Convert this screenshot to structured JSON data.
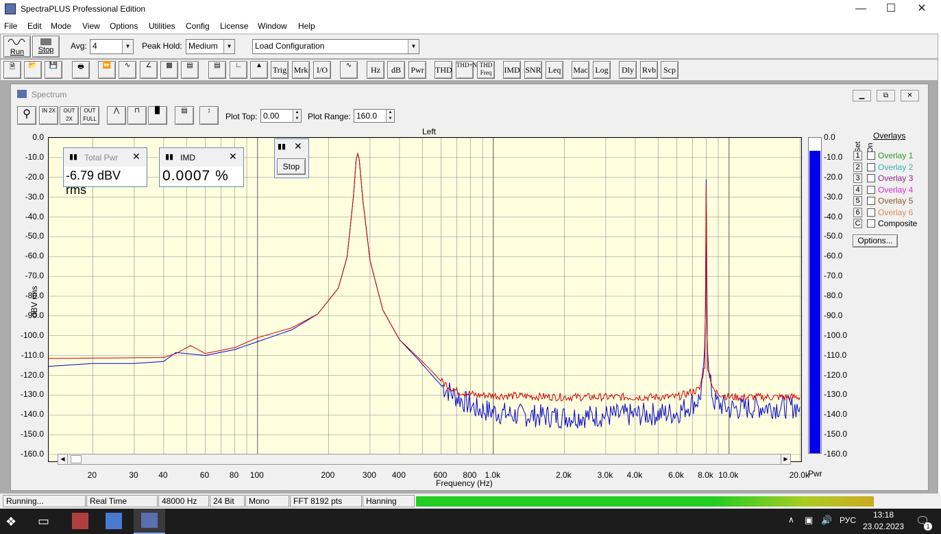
{
  "titlebar": {
    "title": "SpectraPLUS Professional Edition"
  },
  "menu": [
    "File",
    "Edit",
    "Mode",
    "View",
    "Options",
    "Utilities",
    "Config",
    "License",
    "Window",
    "Help"
  ],
  "toolbar1": {
    "run_label": "Run",
    "stop_label": "Stop",
    "avg_label": "Avg:",
    "avg_value": "4",
    "peak_hold_label": "Peak Hold:",
    "peak_hold_value": "Medium",
    "config_value": "Load Configuration"
  },
  "toolbar2": {
    "text_buttons": [
      "Trig",
      "Mrk",
      "I/O",
      "Hz",
      "dB",
      "Pwr",
      "THD",
      "THD+N",
      "THD Freq",
      "IMD",
      "SNR",
      "Leq",
      "Mac",
      "Log",
      "Dly",
      "Rvb",
      "Scp"
    ]
  },
  "spectrum": {
    "title": "Spectrum",
    "zoom_buttons": [
      "IN 2X",
      "OUT 2X",
      "OUT FULL"
    ],
    "plot_top_label": "Plot Top:",
    "plot_top_value": "0.00",
    "plot_range_label": "Plot Range:",
    "plot_range_value": "160.0",
    "channel": "Left",
    "overlays": {
      "title": "Overlays",
      "set_label": "Set",
      "on_label": "On",
      "items": [
        {
          "num": "1",
          "name": "Overlay 1",
          "color": "#2a9a2a"
        },
        {
          "num": "2",
          "name": "Overlay 2",
          "color": "#3aaeb8"
        },
        {
          "num": "3",
          "name": "Overlay 3",
          "color": "#8a2a8a"
        },
        {
          "num": "4",
          "name": "Overlay 4",
          "color": "#d030d0"
        },
        {
          "num": "5",
          "name": "Overlay 5",
          "color": "#8a5a2a"
        },
        {
          "num": "6",
          "name": "Overlay 6",
          "color": "#e08a5a"
        },
        {
          "num": "C",
          "name": "Composite",
          "color": "#000000"
        }
      ],
      "options_label": "Options..."
    },
    "total_pwr": {
      "title": "Total Pwr",
      "value": "-6.79 dBV rms"
    },
    "imd": {
      "title": "IMD",
      "value": "0.0007 %"
    },
    "mini_stop_label": "Stop",
    "pwr_level_db": -6.79
  },
  "chart_data": {
    "type": "line",
    "xlabel": "Frequency (Hz)",
    "ylabel": "dBV rms",
    "xscale": "log",
    "xlim": [
      13,
      20500
    ],
    "ylim": [
      -160,
      0
    ],
    "x_ticks": [
      "20",
      "30",
      "40",
      "60",
      "80",
      "100",
      "200",
      "300",
      "400",
      "600",
      "800",
      "1.0k",
      "2.0k",
      "3.0k",
      "4.0k",
      "6.0k",
      "8.0k",
      "10.0k",
      "20.0k"
    ],
    "x_tick_values": [
      20,
      30,
      40,
      60,
      80,
      100,
      200,
      300,
      400,
      600,
      800,
      1000,
      2000,
      3000,
      4000,
      6000,
      8000,
      10000,
      20000
    ],
    "y_ticks": [
      "0.0",
      "-10.0",
      "-20.0",
      "-30.0",
      "-40.0",
      "-50.0",
      "-60.0",
      "-70.0",
      "-80.0",
      "-90.0",
      "-100.0",
      "-110.0",
      "-120.0",
      "-130.0",
      "-140.0",
      "-150.0",
      "-160.0"
    ],
    "right_label": "Pwr",
    "grid": true,
    "series": [
      {
        "color": "#0000cc",
        "points": [
          [
            13,
            -115.5
          ],
          [
            20,
            -114
          ],
          [
            30,
            -114
          ],
          [
            40,
            -113
          ],
          [
            45,
            -108.5
          ],
          [
            50,
            -109
          ],
          [
            60,
            -110
          ],
          [
            80,
            -107
          ],
          [
            100,
            -103
          ],
          [
            140,
            -97
          ],
          [
            180,
            -89
          ],
          [
            220,
            -76
          ],
          [
            240,
            -60
          ],
          [
            255,
            -30
          ],
          [
            262,
            -11
          ],
          [
            266,
            -8
          ],
          [
            270,
            -11
          ],
          [
            280,
            -32
          ],
          [
            300,
            -62
          ],
          [
            340,
            -87
          ],
          [
            400,
            -102
          ],
          [
            480,
            -112
          ],
          [
            550,
            -120
          ],
          [
            600,
            -125
          ],
          [
            700,
            -131
          ],
          [
            850,
            -137
          ],
          [
            1200,
            -140
          ],
          [
            2000,
            -141
          ],
          [
            4000,
            -140
          ],
          [
            6000,
            -139
          ],
          [
            7500,
            -132
          ],
          [
            7800,
            -120
          ],
          [
            7950,
            -90
          ],
          [
            8000,
            -20
          ],
          [
            8050,
            -90
          ],
          [
            8200,
            -120
          ],
          [
            8600,
            -133
          ],
          [
            10000,
            -137
          ],
          [
            14000,
            -136
          ],
          [
            20000,
            -136
          ]
        ]
      },
      {
        "color": "#cc0000",
        "points": [
          [
            13,
            -111.5
          ],
          [
            40,
            -111
          ],
          [
            45,
            -109
          ],
          [
            52,
            -105
          ],
          [
            60,
            -109
          ],
          [
            80,
            -106
          ],
          [
            100,
            -101
          ],
          [
            140,
            -96
          ],
          [
            180,
            -89
          ],
          [
            220,
            -76
          ],
          [
            240,
            -60
          ],
          [
            255,
            -30
          ],
          [
            262,
            -11
          ],
          [
            266,
            -8
          ],
          [
            270,
            -11
          ],
          [
            280,
            -32
          ],
          [
            300,
            -62
          ],
          [
            340,
            -87
          ],
          [
            400,
            -102
          ],
          [
            480,
            -111
          ],
          [
            550,
            -118
          ],
          [
            600,
            -123
          ],
          [
            700,
            -128
          ],
          [
            850,
            -130
          ],
          [
            2000,
            -131
          ],
          [
            6000,
            -131
          ],
          [
            7500,
            -127
          ],
          [
            7900,
            -115
          ],
          [
            8000,
            -25
          ],
          [
            8100,
            -115
          ],
          [
            8600,
            -128
          ],
          [
            10000,
            -131
          ],
          [
            14000,
            -131
          ],
          [
            20000,
            -131
          ]
        ]
      }
    ]
  },
  "statusbar": {
    "state": "Running...",
    "mode": "Real Time",
    "rate": "48000 Hz",
    "bits": "24 Bit",
    "channels": "Mono",
    "fft": "FFT 8192 pts",
    "window": "Hanning"
  },
  "taskbar": {
    "lang": "РУС",
    "time": "13:18",
    "date": "23.02.2023",
    "notif_count": "1"
  }
}
